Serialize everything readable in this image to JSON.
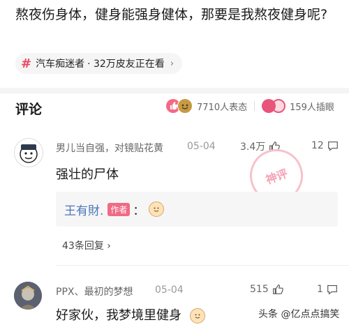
{
  "post": {
    "title": "熬夜伤身体，健身能强身健体，那要是我熬夜健身呢?"
  },
  "topic": {
    "name": "汽车痴迷者",
    "viewers": "· 32万皮友正在看"
  },
  "comments_header": {
    "title": "评论",
    "reactions": "7710人表态",
    "illustrations": "159人插眼"
  },
  "comments": [
    {
      "user": "男儿当自强，对镜贴花黄",
      "date": "05-04",
      "likes": "3.4万",
      "replies_count": "12",
      "text": "强壮的尸体",
      "hot_stamp": "神评",
      "reply": {
        "name": "王有財.",
        "badge": "作者",
        "colon": "："
      },
      "more_replies": "43条回复 ›"
    },
    {
      "user": "PPX、最初的梦想",
      "date": "05-04",
      "likes": "515",
      "replies_count": "1",
      "text": "好家伙，我梦境里健身"
    }
  ],
  "watermark": "头条 @亿点点搞笑",
  "icons": {
    "topic": "hashtag-icon",
    "like": "thumb-up-icon",
    "reply": "comment-icon",
    "smile": "smiley-icon"
  },
  "colors": {
    "accent": "#e94863",
    "reply_name": "#4a76b8"
  }
}
